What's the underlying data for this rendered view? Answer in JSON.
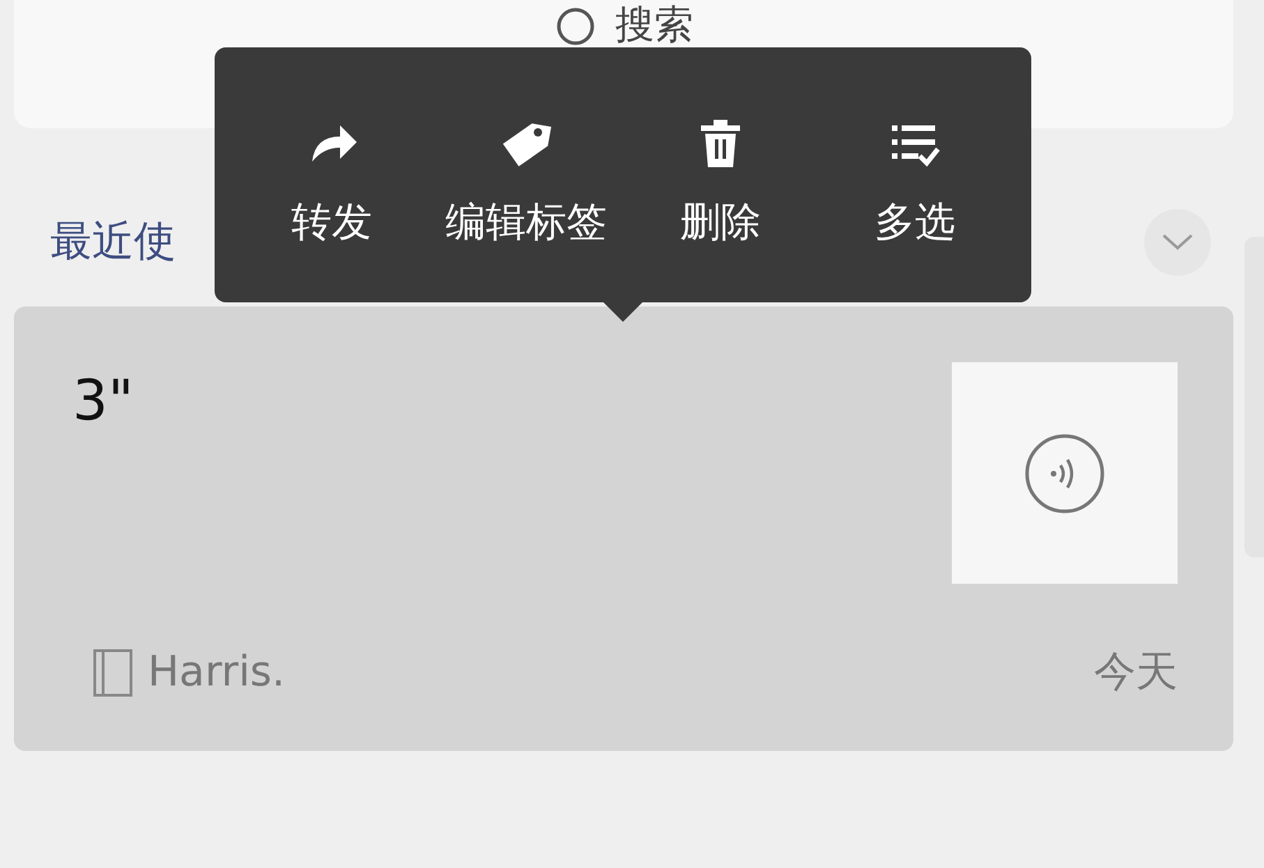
{
  "search": {
    "placeholder": "搜索"
  },
  "section": {
    "title": "最近使"
  },
  "context_menu": {
    "items": [
      {
        "kind": "forward",
        "label": "转发"
      },
      {
        "kind": "tag",
        "label": "编辑标签"
      },
      {
        "kind": "delete",
        "label": "删除"
      },
      {
        "kind": "multiselect",
        "label": "多选"
      }
    ]
  },
  "note": {
    "title": "3\"",
    "notebook": "Harris.",
    "date": "今天"
  }
}
